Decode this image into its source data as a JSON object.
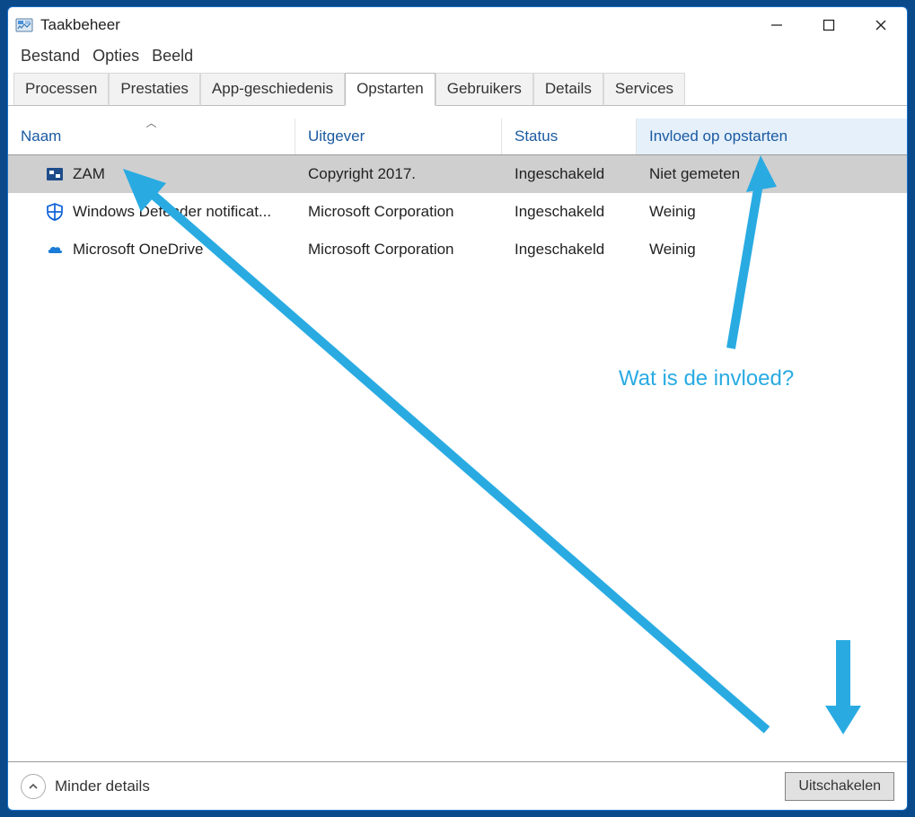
{
  "window": {
    "title": "Taakbeheer"
  },
  "menu": {
    "file": "Bestand",
    "options": "Opties",
    "view": "Beeld"
  },
  "tabs": {
    "processes": "Processen",
    "performance": "Prestaties",
    "history": "App-geschiedenis",
    "startup": "Opstarten",
    "users": "Gebruikers",
    "details": "Details",
    "services": "Services"
  },
  "columns": {
    "name": "Naam",
    "publisher": "Uitgever",
    "status": "Status",
    "impact": "Invloed op opstarten"
  },
  "rows": [
    {
      "name": "ZAM",
      "publisher": "Copyright 2017.",
      "status": "Ingeschakeld",
      "impact": "Niet gemeten"
    },
    {
      "name": "Windows Defender notificat...",
      "publisher": "Microsoft Corporation",
      "status": "Ingeschakeld",
      "impact": "Weinig"
    },
    {
      "name": "Microsoft OneDrive",
      "publisher": "Microsoft Corporation",
      "status": "Ingeschakeld",
      "impact": "Weinig"
    }
  ],
  "footer": {
    "less_details": "Minder details",
    "disable": "Uitschakelen"
  },
  "annotation": {
    "question": "Wat is de invloed?"
  }
}
